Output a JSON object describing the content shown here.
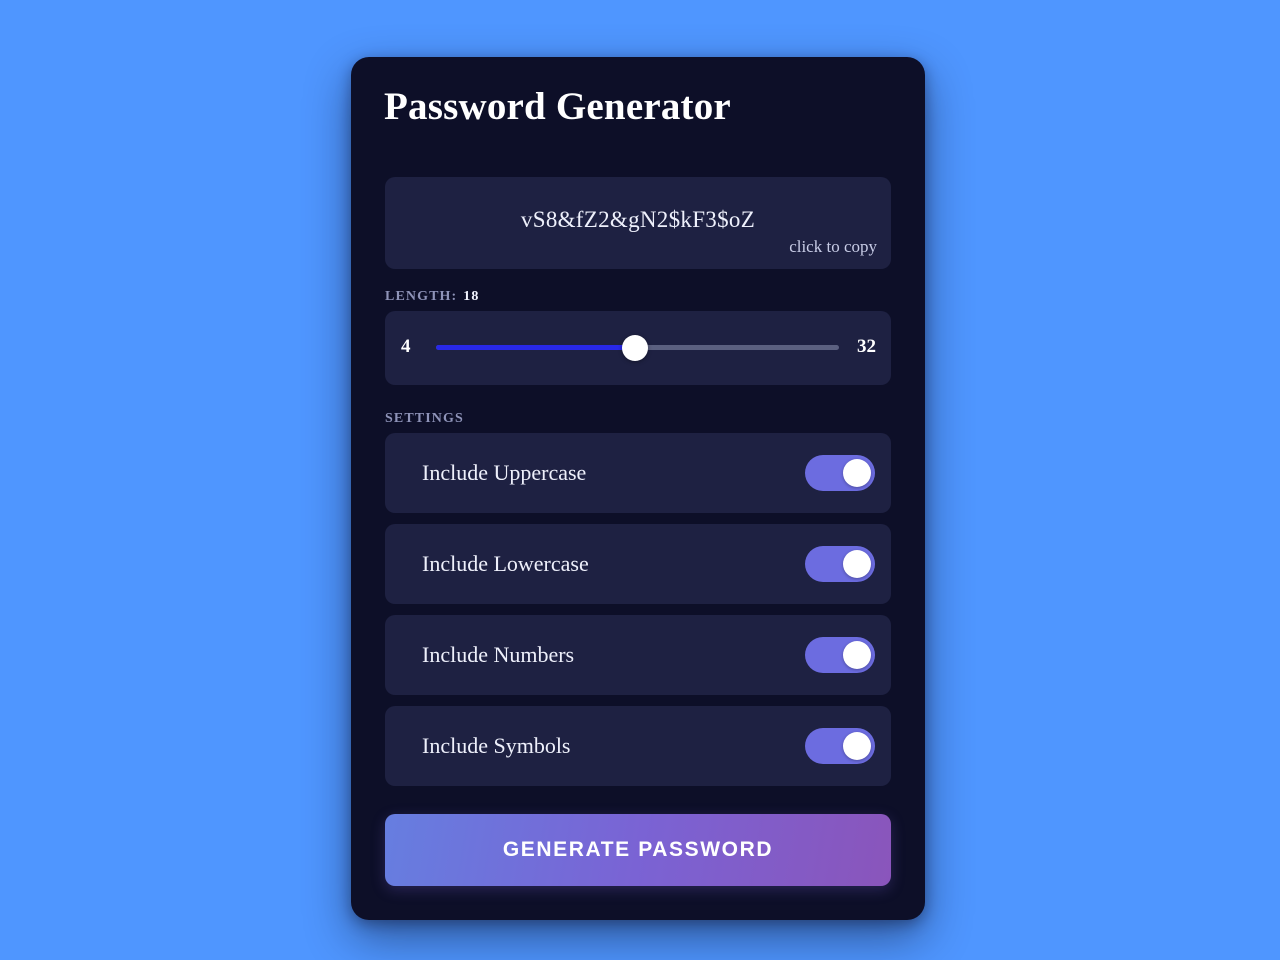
{
  "app": {
    "title": "Password Generator"
  },
  "password_display": {
    "value": "vS8&fZ2&gN2$kF3$oZ",
    "copy_hint": "click to copy"
  },
  "length": {
    "label": "LENGTH:",
    "value": "18",
    "min": "4",
    "max": "32",
    "fill_percent": 49.3
  },
  "settings": {
    "label": "SETTINGS",
    "options": [
      {
        "label": "Include Uppercase",
        "enabled": true
      },
      {
        "label": "Include Lowercase",
        "enabled": true
      },
      {
        "label": "Include Numbers",
        "enabled": true
      },
      {
        "label": "Include Symbols",
        "enabled": true
      }
    ]
  },
  "actions": {
    "generate_label": "GENERATE PASSWORD"
  },
  "colors": {
    "page_background": "#4f96ff",
    "card_background": "#0d0f28",
    "panel_background": "#1e2142",
    "slider_fill": "#2828e8",
    "slider_track": "#5b6080",
    "toggle_on": "#6c6ce0",
    "button_gradient_start": "#667ee0",
    "button_gradient_end": "#8a55bb",
    "text_primary": "#eef0fb",
    "text_muted": "#8e93b8"
  }
}
